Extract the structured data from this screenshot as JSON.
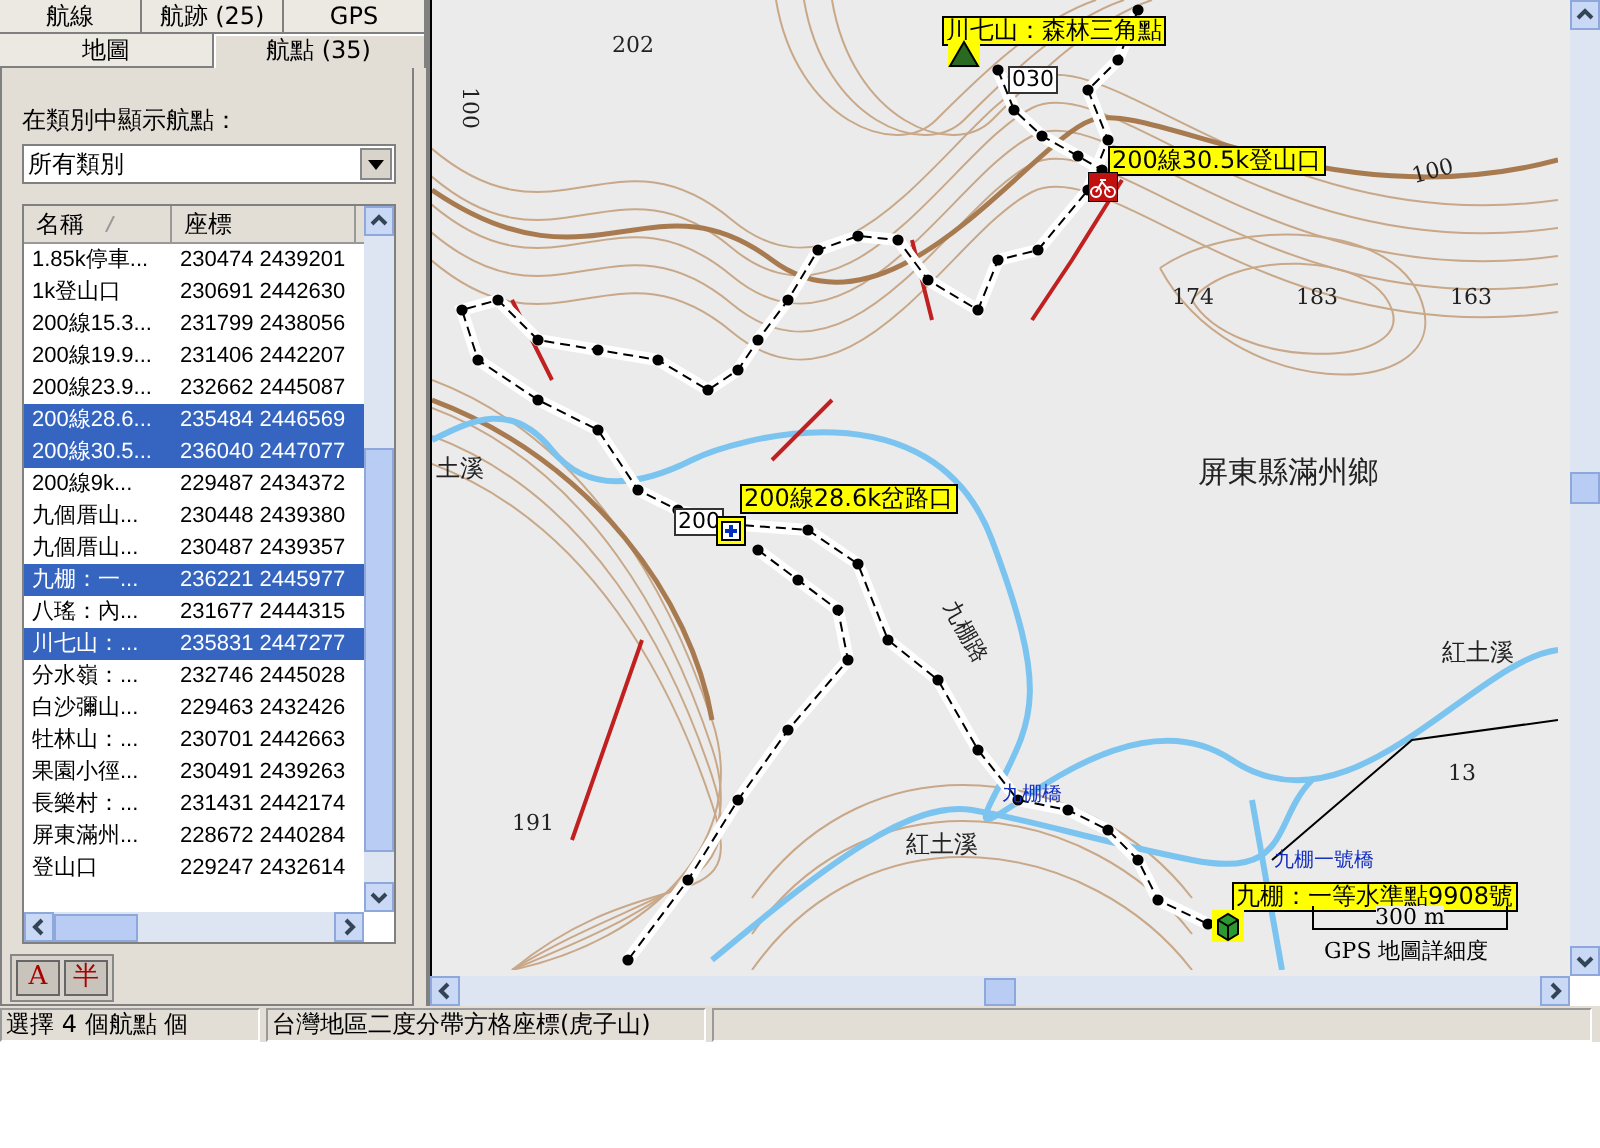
{
  "tab_rows": [
    {
      "tabs": [
        {
          "label": "航線",
          "selected": false
        },
        {
          "label": "航跡 (25)",
          "selected": false
        },
        {
          "label": "GPS",
          "selected": false
        }
      ]
    },
    {
      "tabs": [
        {
          "label": "地圖",
          "selected": false
        },
        {
          "label": "航點 (35)",
          "selected": true
        }
      ]
    }
  ],
  "waypoint_panel": {
    "category_label": "在類別中顯示航點：",
    "category_select": {
      "value": "所有類別"
    },
    "list": {
      "columns": [
        {
          "label": "名稱",
          "sorted": true
        },
        {
          "label": "座標",
          "sorted": false
        }
      ],
      "rows": [
        {
          "name": "1.85k停車...",
          "coordinates": "230474 2439201",
          "selected": false
        },
        {
          "name": "1k登山口",
          "coordinates": "230691 2442630",
          "selected": false
        },
        {
          "name": "200線15.3...",
          "coordinates": "231799 2438056",
          "selected": false
        },
        {
          "name": "200線19.9...",
          "coordinates": "231406 2442207",
          "selected": false
        },
        {
          "name": "200線23.9...",
          "coordinates": "232662 2445087",
          "selected": false
        },
        {
          "name": "200線28.6...",
          "coordinates": "235484 2446569",
          "selected": true
        },
        {
          "name": "200線30.5...",
          "coordinates": "236040 2447077",
          "selected": true
        },
        {
          "name": "200線9k...",
          "coordinates": "229487 2434372",
          "selected": false
        },
        {
          "name": "九個厝山...",
          "coordinates": "230448 2439380",
          "selected": false
        },
        {
          "name": "九個厝山...",
          "coordinates": "230487 2439357",
          "selected": false
        },
        {
          "name": "九棚：一...",
          "coordinates": "236221 2445977",
          "selected": true
        },
        {
          "name": "八瑤：內...",
          "coordinates": "231677 2444315",
          "selected": false
        },
        {
          "name": "川七山：...",
          "coordinates": "235831 2447277",
          "selected": true
        },
        {
          "name": "分水嶺：...",
          "coordinates": "232746 2445028",
          "selected": false
        },
        {
          "name": "白沙彌山...",
          "coordinates": "229463 2432426",
          "selected": false
        },
        {
          "name": "牡林山：...",
          "coordinates": "230701 2442663",
          "selected": false
        },
        {
          "name": "果園小徑...",
          "coordinates": "230491 2439263",
          "selected": false
        },
        {
          "name": "長樂村：...",
          "coordinates": "231431 2442174",
          "selected": false
        },
        {
          "name": "屏東滿州...",
          "coordinates": "228672 2440284",
          "selected": false
        },
        {
          "name": "登山口",
          "coordinates": "229247 2432614",
          "selected": false
        }
      ]
    }
  },
  "ime_toolbar": {
    "buttons": [
      "A",
      "半"
    ]
  },
  "map": {
    "labels": [
      {
        "kind": "waypoint",
        "text": "川七山：森林三角點"
      },
      {
        "kind": "shield",
        "text": "030"
      },
      {
        "kind": "waypoint",
        "text": "200線30.5k登山口"
      },
      {
        "kind": "elevation",
        "text": "202"
      },
      {
        "kind": "contour",
        "text": "100"
      },
      {
        "kind": "contour",
        "text": "100"
      },
      {
        "kind": "elevation",
        "text": "174"
      },
      {
        "kind": "elevation",
        "text": "183"
      },
      {
        "kind": "elevation",
        "text": "163"
      },
      {
        "kind": "place",
        "text": "土溪"
      },
      {
        "kind": "shield",
        "text": "200"
      },
      {
        "kind": "waypoint",
        "text": "200線28.6k岔路口"
      },
      {
        "kind": "region",
        "text": "屏東縣滿州鄉"
      },
      {
        "kind": "place",
        "text": "紅土溪"
      },
      {
        "kind": "road",
        "text": "九棚路"
      },
      {
        "kind": "bridge",
        "text": "九棚橋"
      },
      {
        "kind": "elevation",
        "text": "13"
      },
      {
        "kind": "place",
        "text": "紅土溪"
      },
      {
        "kind": "elevation",
        "text": "191"
      },
      {
        "kind": "bridge",
        "text": "九棚一號橋"
      },
      {
        "kind": "waypoint",
        "text": "九棚：一等水準點9908號"
      }
    ],
    "scale": {
      "distance": "300 m",
      "caption": "GPS 地圖詳細度"
    }
  },
  "status_bar": {
    "panels": [
      "選擇 4 個航點 個",
      "台灣地區二度分帶方格座標(虎子山)"
    ]
  }
}
